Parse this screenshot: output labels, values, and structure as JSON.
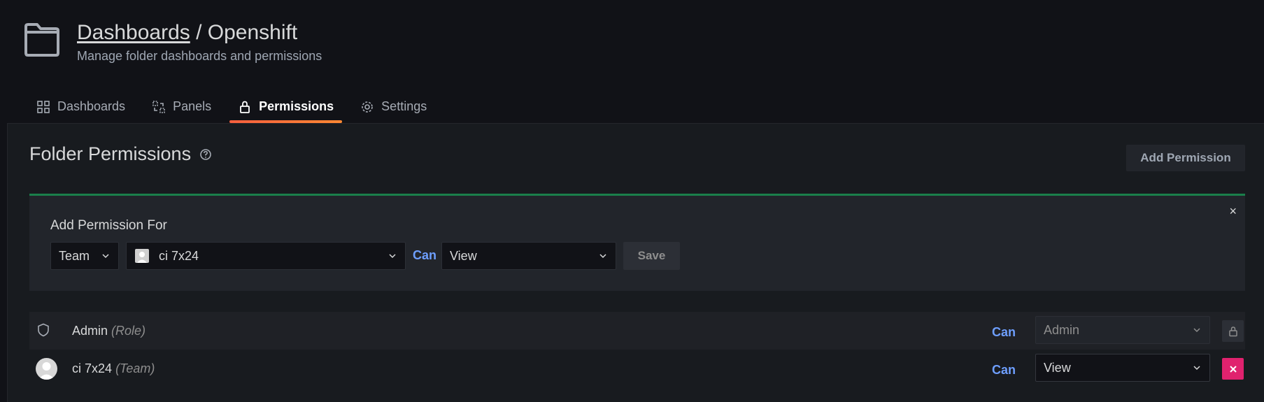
{
  "header": {
    "breadcrumb_link": "Dashboards",
    "separator": " / ",
    "folder_name": "Openshift",
    "subtitle": "Manage folder dashboards and permissions"
  },
  "tabs": [
    {
      "label": "Dashboards",
      "icon": "grid-icon"
    },
    {
      "label": "Panels",
      "icon": "library-panels-icon"
    },
    {
      "label": "Permissions",
      "icon": "lock-icon",
      "active": true
    },
    {
      "label": "Settings",
      "icon": "gear-icon"
    }
  ],
  "section": {
    "title": "Folder Permissions",
    "add_button": "Add Permission"
  },
  "add_permission": {
    "title": "Add Permission For",
    "close": "×",
    "type_value": "Team",
    "team_value": "ci 7x24",
    "can_label": "Can",
    "permission_value": "View",
    "save_label": "Save"
  },
  "permissions": [
    {
      "name": "Admin",
      "kind": "(Role)",
      "can": "Can",
      "permission": "Admin",
      "locked": true
    },
    {
      "name": "ci 7x24",
      "kind": "(Team)",
      "can": "Can",
      "permission": "View",
      "locked": false
    }
  ],
  "colors": {
    "accent_blue": "#6e9fff",
    "tab_active": "#ff8833",
    "success": "#1a7f4b",
    "danger": "#e0226e"
  }
}
